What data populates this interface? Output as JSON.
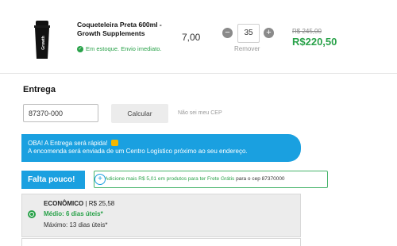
{
  "product": {
    "name": "Coqueteleira Preta 600ml - Growth Supplements",
    "stock_status": "Em estoque. Envio imediato.",
    "unit_price": "7,00",
    "quantity": "35",
    "remove_label": "Remover",
    "old_price": "R$ 245,00",
    "new_price": "R$220,50",
    "image_label": "Growth"
  },
  "delivery": {
    "heading": "Entrega",
    "cep_value": "87370-000",
    "calculate_label": "Calcular",
    "dont_know_cep": "Não sei meu CEP",
    "banner_line1": "OBA! A Entrega será rápida!",
    "banner_line2": "A encomenda será enviada de um Centro Logístico próximo ao seu endereço.",
    "falta_label": "Falta pouco!",
    "free_shipping_text": "Adicione mais R$ 5,01 em produtos para ter Frete Grátis",
    "free_shipping_cep": "para o cep 87370000"
  },
  "shipping_option": {
    "name": "ECONÔMICO",
    "price": "| R$ 25,58",
    "medio": "Médio: 6 dias úteis*",
    "maximo": "Máximo: 13 dias úteis*"
  },
  "colors": {
    "accent_blue": "#1aa0e0",
    "price_green": "#2aa24a"
  }
}
